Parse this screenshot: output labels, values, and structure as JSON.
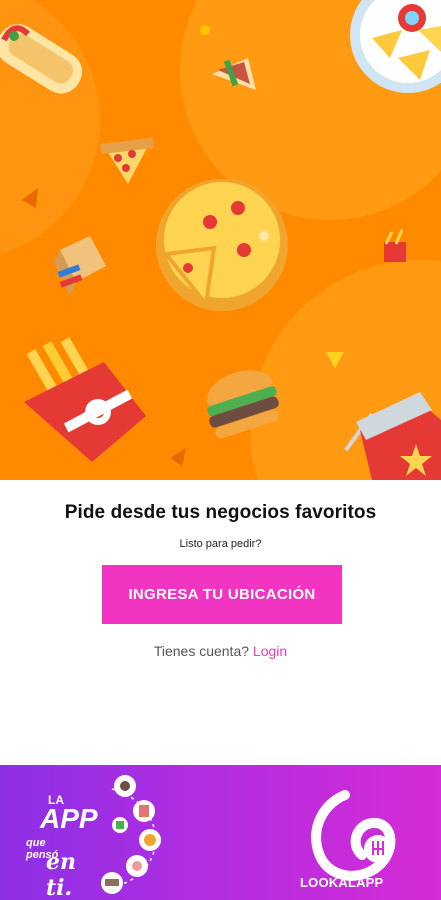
{
  "content": {
    "headline": "Pide desde tus negocios favoritos",
    "subline": "Listo para pedir?",
    "cta_label": "INGRESA TU UBICACIÓN",
    "account_prompt": "Tienes cuenta?",
    "login_label": "Login"
  },
  "banner": {
    "tagline_la": "LA",
    "tagline_app": "APP",
    "tagline_que": "que pensó",
    "tagline_con": "en ti.",
    "brand_name": "LOOKALAPP"
  },
  "colors": {
    "hero_bg": "#ff8a00",
    "cta_bg": "#f135c2",
    "login_link": "#e83fc0",
    "banner_start": "#8d2fe6",
    "banner_end": "#d62bd6"
  },
  "icons": [
    "burrito-icon",
    "sandwich-icon",
    "nachos-icon",
    "pizza-slice-icon",
    "pizza-icon",
    "drink-box-icon",
    "fries-icon",
    "burger-icon",
    "soda-cup-icon",
    "cake-icon",
    "logo-icon"
  ]
}
